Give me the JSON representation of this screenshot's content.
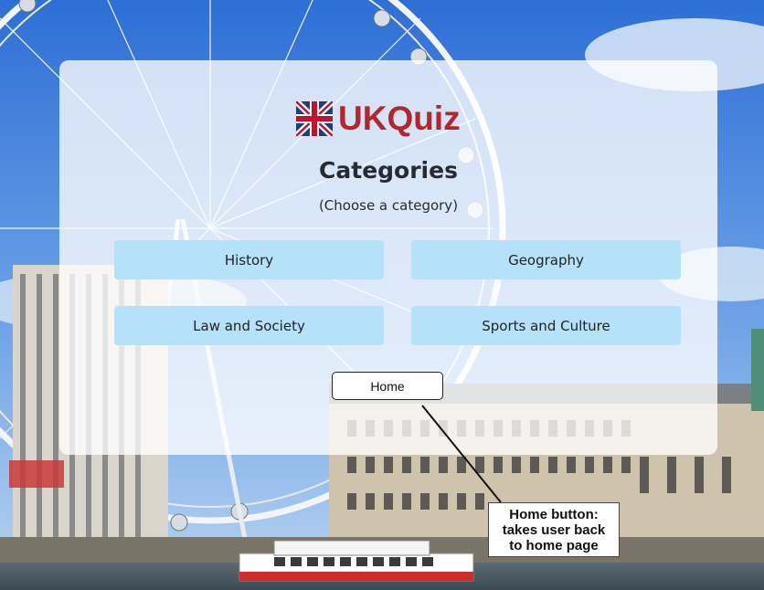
{
  "app": {
    "logo_text": "UKQuiz",
    "brand_color": "#b3262d",
    "logo_icon": "union-jack-flag-icon"
  },
  "page": {
    "title": "Categories",
    "subtitle": "(Choose a category)"
  },
  "categories": [
    {
      "label": "History"
    },
    {
      "label": "Geography"
    },
    {
      "label": "Law and Society"
    },
    {
      "label": "Sports and Culture"
    }
  ],
  "navigation": {
    "home_label": "Home"
  },
  "annotation": {
    "lines": [
      "Home button:",
      "takes user back",
      "to home page"
    ]
  },
  "colors": {
    "category_button": "#b6e2f9",
    "card": "rgba(255,255,255,0.78)"
  }
}
